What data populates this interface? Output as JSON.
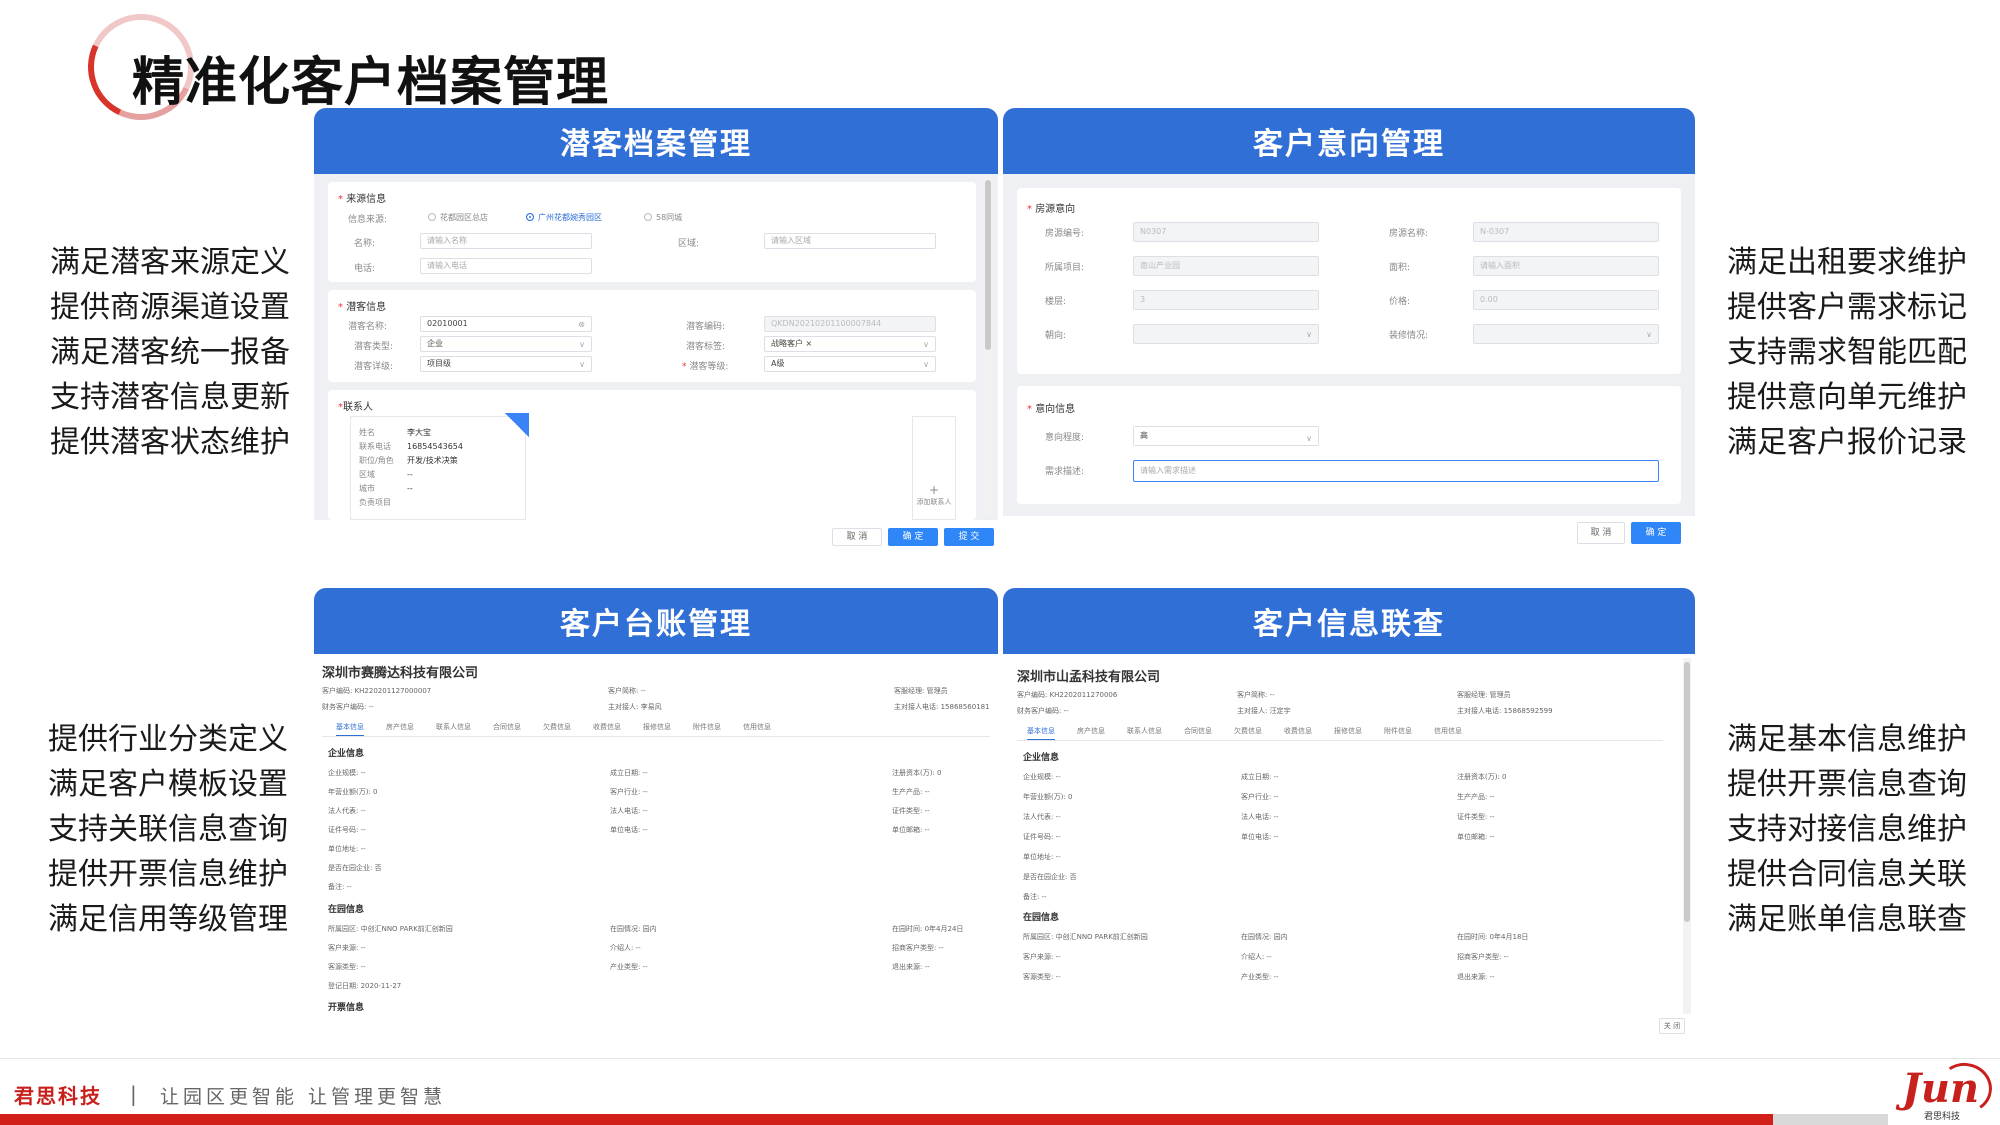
{
  "slide": {
    "title": "精准化客户档案管理"
  },
  "left_top_list": [
    "满足潜客来源定义",
    "提供商源渠道设置",
    "满足潜客统一报备",
    "支持潜客信息更新",
    "提供潜客状态维护"
  ],
  "left_bottom_list": [
    "提供行业分类定义",
    "满足客户模板设置",
    "支持关联信息查询",
    "提供开票信息维护",
    "满足信用等级管理"
  ],
  "right_top_list": [
    "满足出租要求维护",
    "提供客户需求标记",
    "支持需求智能匹配",
    "提供意向单元维护",
    "满足客户报价记录"
  ],
  "right_bottom_list": [
    "满足基本信息维护",
    "提供开票信息查询",
    "支持对接信息维护",
    "提供合同信息关联",
    "满足账单信息联查"
  ],
  "panels": {
    "p1": {
      "title": "潜客档案管理",
      "source_section": "来源信息",
      "source_label": "信息来源:",
      "radios": [
        "花都园区总店",
        "广州花都婉秀园区",
        "58同城"
      ],
      "name_label": "名称:",
      "name_placeholder": "请输入名称",
      "area_label": "区域:",
      "area_placeholder": "请输入区域",
      "phone_label": "电话:",
      "phone_placeholder": "请输入电话",
      "prospect_section": "潜客信息",
      "prospect_name_label": "潜客名称:",
      "prospect_name_value": "02010001",
      "prospect_code_label": "潜客编码:",
      "prospect_code_value": "QKDN20210201100007844",
      "prospect_type_label": "潜客类型:",
      "prospect_type_value": "企业",
      "prospect_tag_label": "潜客标签:",
      "prospect_tag_value": "战略客户",
      "prospect_detail_label": "潜客详级:",
      "prospect_detail_value": "项目级",
      "prospect_level_label": "潜客等级:",
      "prospect_level_value": "A级",
      "contact_section": "联系人",
      "contact_fields": [
        {
          "k": "姓名",
          "v": "李大宝"
        },
        {
          "k": "联系电话",
          "v": "16854543654"
        },
        {
          "k": "职位/角色",
          "v": "开发/技术决策"
        },
        {
          "k": "区域",
          "v": "--"
        },
        {
          "k": "城市",
          "v": "--"
        },
        {
          "k": "负责项目",
          "v": ""
        }
      ],
      "add_contact": "添加联系人",
      "btn_cancel": "取 消",
      "btn_ok": "确 定",
      "btn_submit": "提 交"
    },
    "p2": {
      "title": "客户意向管理",
      "room_section": "房源意向",
      "room_no_label": "房源编号:",
      "room_no_value": "N0307",
      "room_name_label": "房源名称:",
      "room_name_value": "N-0307",
      "project_label": "所属项目:",
      "project_value": "南山产业园",
      "area_label": "面积:",
      "area_placeholder": "请输入面积",
      "floor_label": "楼层:",
      "floor_value": "3",
      "price_label": "价格:",
      "price_value": "0.00",
      "orient_label": "朝向:",
      "decor_label": "装修情况:",
      "intent_section": "意向信息",
      "degree_label": "意向程度:",
      "degree_value": "高",
      "desc_label": "需求描述:",
      "desc_placeholder": "请输入需求描述",
      "btn_cancel": "取 消",
      "btn_ok": "确 定"
    },
    "p3": {
      "title": "客户台账管理",
      "company": "深圳市赛腾达科技有限公司",
      "meta": [
        "客户编码: KH220201127000007",
        "客户简称: --",
        "客服经理: 管理员",
        "财务客户编码: --",
        "主对接人: 李易风",
        "主对接人电话: 15868560181"
      ],
      "tabs": [
        "基本信息",
        "房产信息",
        "联系人信息",
        "合同信息",
        "欠费信息",
        "收费信息",
        "报修信息",
        "附件信息",
        "信用信息"
      ],
      "enterprise_section": "企业信息",
      "ent_rows": [
        [
          "企业规模: --",
          "成立日期: --",
          "注册资本(万): 0"
        ],
        [
          "年营业额(万): 0",
          "客户行业: --",
          "生产产品: --"
        ],
        [
          "法人代表: --",
          "法人电话: --",
          "证件类型: --"
        ],
        [
          "证件号码: --",
          "单位电话: --",
          "单位邮箱: --"
        ],
        [
          "单位地址: --",
          "",
          ""
        ],
        [
          "是否在园企业: 否",
          "",
          ""
        ],
        [
          "备注: --",
          "",
          ""
        ]
      ],
      "park_section": "在园信息",
      "park_rows": [
        [
          "所属园区: 中创汇NNO PARK前汇创新园",
          "在园情况: 园内",
          "在园时间: 0年4月24日"
        ],
        [
          "客户来源: --",
          "介绍人: --",
          "招商客户类型: --"
        ],
        [
          "客源类型: --",
          "产业类型: --",
          "退出来源: --"
        ],
        [
          "登记日期: 2020-11-27",
          "",
          ""
        ]
      ],
      "invoice_section": "开票信息"
    },
    "p4": {
      "title": "客户信息联查",
      "company": "深圳市山孟科技有限公司",
      "meta": [
        "客户编码: KH2202011270006",
        "客户简称: --",
        "客服经理: 管理员",
        "财务客户编码: --",
        "主对接人: 汪定宇",
        "主对接人电话: 15868592599"
      ],
      "tabs": [
        "基本信息",
        "房产信息",
        "联系人信息",
        "合同信息",
        "欠费信息",
        "收费信息",
        "报修信息",
        "附件信息",
        "信用信息"
      ],
      "enterprise_section": "企业信息",
      "ent_rows": [
        [
          "企业规模: --",
          "成立日期: --",
          "注册资本(万): 0"
        ],
        [
          "年营业额(万): 0",
          "客户行业: --",
          "生产产品: --"
        ],
        [
          "法人代表: --",
          "法人电话: --",
          "证件类型: --"
        ],
        [
          "证件号码: --",
          "单位电话: --",
          "单位邮箱: --"
        ],
        [
          "单位地址: --",
          "",
          ""
        ],
        [
          "是否在园企业: 否",
          "",
          ""
        ],
        [
          "备注: --",
          "",
          ""
        ]
      ],
      "park_section": "在园信息",
      "park_rows": [
        [
          "所属园区: 中创汇NNO PARK前汇创新园",
          "在园情况: 园内",
          "在园时间: 0年4月18日"
        ],
        [
          "客户来源: --",
          "介绍人: --",
          "招商客户类型: --"
        ],
        [
          "客源类型: --",
          "产业类型: --",
          "退出来源: --"
        ]
      ],
      "btn_close": "关 闭"
    }
  },
  "footer": {
    "brand": "君思科技",
    "divider": "|",
    "slogan": "让园区更智能  让管理更智慧",
    "logo_text": "Jun",
    "logo_sub": "君思科技"
  },
  "colors": {
    "panel_header": "#2f6fd6",
    "brand_red": "#d21f1a"
  }
}
